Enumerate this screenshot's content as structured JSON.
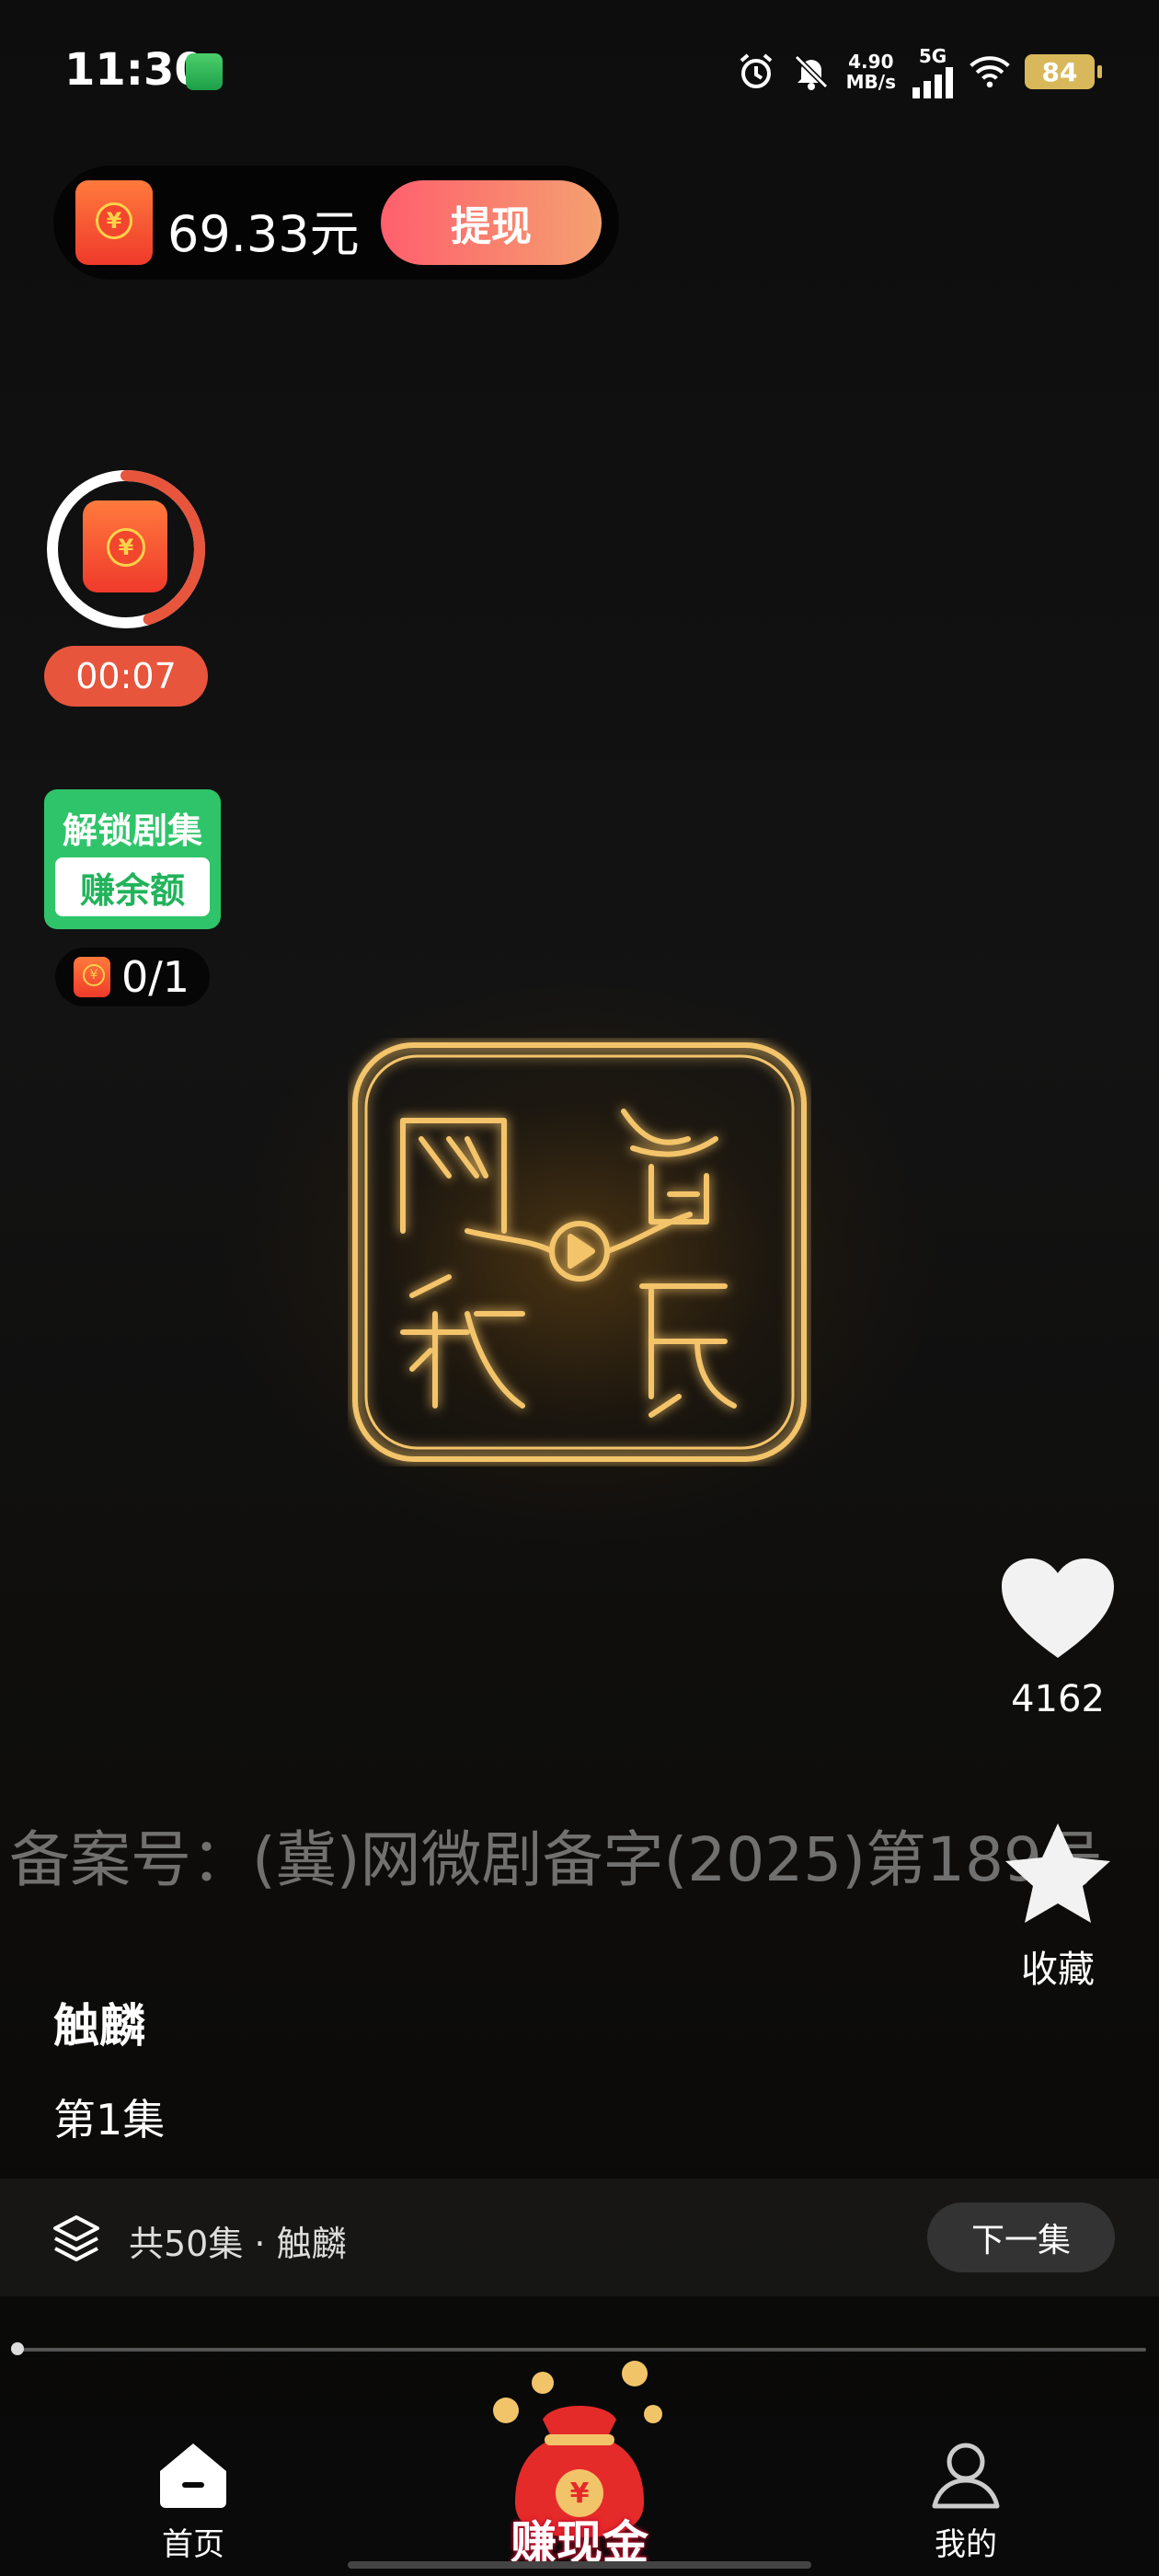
{
  "status_bar": {
    "time": "11:30",
    "net_speed_value": "4.90",
    "net_speed_unit": "MB/s",
    "network": "5G",
    "battery": "84"
  },
  "wallet": {
    "balance": "69.33元",
    "withdraw_label": "提现",
    "coin_symbol": "¥"
  },
  "timer": {
    "time": "00:07",
    "progress": 0.45
  },
  "unlock": {
    "title": "解锁剧集",
    "subtitle": "赚余额",
    "count": "0/1"
  },
  "actions": {
    "like_count": "4162",
    "favorite_label": "收藏"
  },
  "video": {
    "registration": "备案号：(冀)网微剧备字(2025)第189号",
    "drama_title": "触麟",
    "episode_title": "第1集",
    "progress": 0.004
  },
  "episode_bar": {
    "info": "共50集 · 触麟",
    "next_label": "下一集"
  },
  "nav": {
    "home_label": "首页",
    "earn_label": "赚现金",
    "me_label": "我的"
  },
  "colors": {
    "accent_red": "#e8553d",
    "withdraw_gradient_start": "#ff5f6d",
    "withdraw_gradient_end": "#f4a070",
    "unlock_green": "#2fc46a",
    "logo_gold": "#f4c46a"
  }
}
